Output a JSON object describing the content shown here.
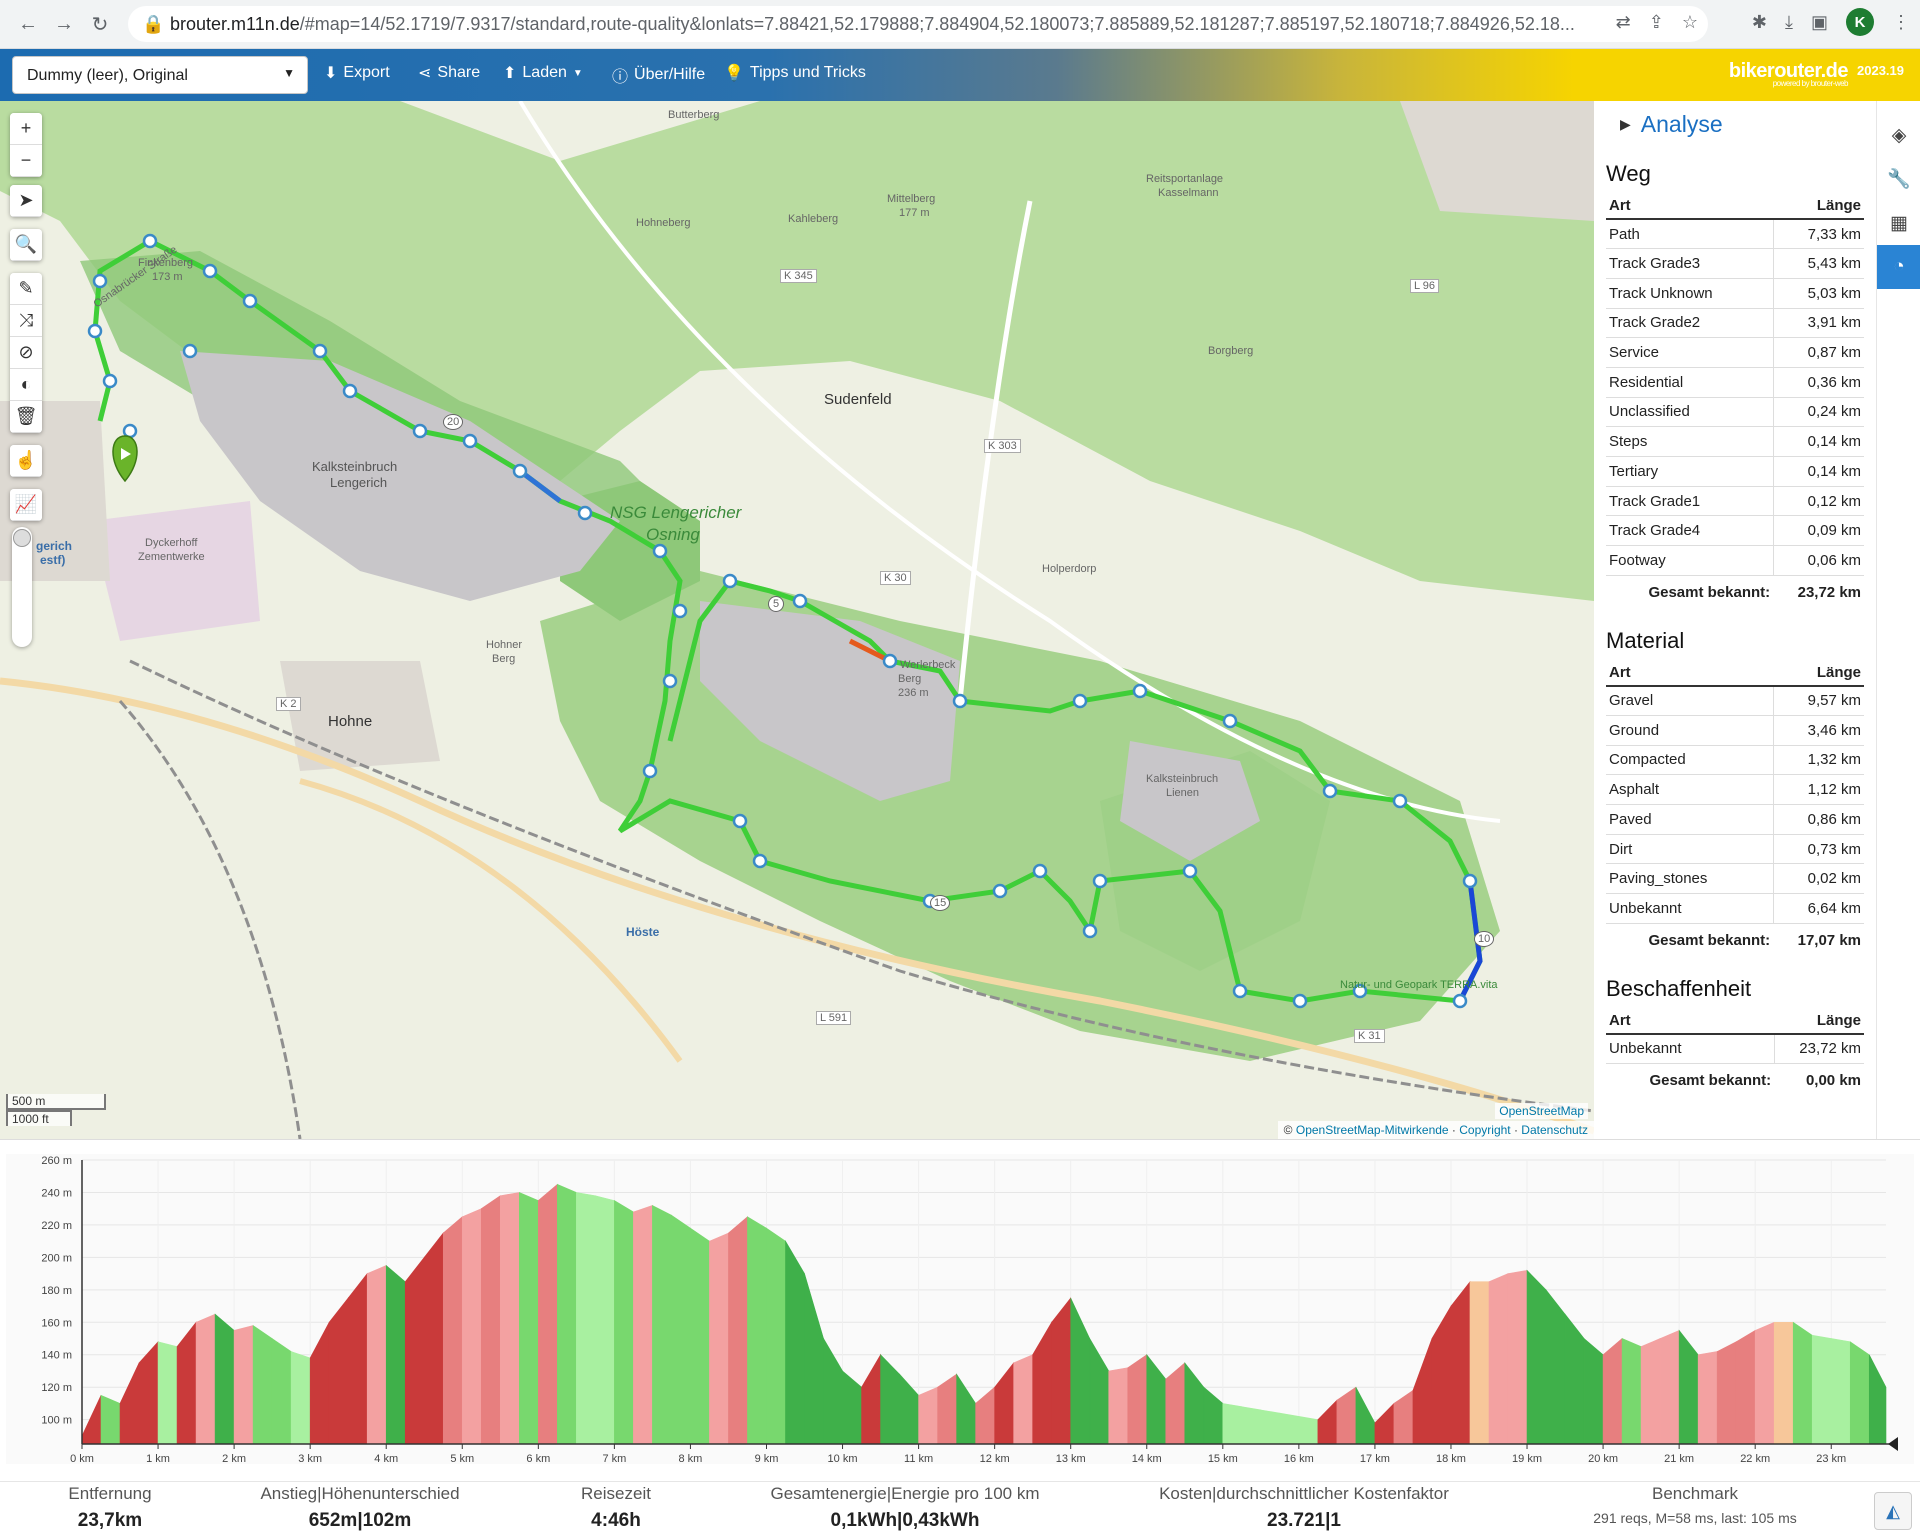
{
  "browser": {
    "url_host": "brouter.m11n.de",
    "url_rest": "/#map=14/52.1719/7.9317/standard,route-quality&lonlats=7.88421,52.179888;7.884904,52.180073;7.885889,52.181287;7.885197,52.180718;7.884926,52.18...",
    "avatar_letter": "K"
  },
  "toolbar": {
    "profile": "Dummy (leer), Original",
    "export": "Export",
    "share": "Share",
    "load": "Laden",
    "about": "Über/Hilfe",
    "tips": "Tipps und Tricks",
    "brand": "bikerouter.de",
    "brand_sub": "powered by brouter-web",
    "version": "2023.19"
  },
  "map": {
    "labels": {
      "butterberg": "Butterberg",
      "hohneberg": "Hohneberg",
      "kahleberg": "Kahleberg",
      "mittelberg": "Mittelberg",
      "mittelberg_h": "177 m",
      "reitsport": "Reitsportanlage",
      "kasselmann": "Kasselmann",
      "borgberg": "Borgberg",
      "sudenfeld": "Sudenfeld",
      "finkenberg": "Finkenberg",
      "finkenberg_h": "173 m",
      "kalkstein1": "Kalksteinbruch",
      "kalkstein1b": "Lengerich",
      "nsg1": "NSG Lengericher",
      "nsg2": "Osning",
      "dyckerhoff": "Dyckerhoff",
      "zementwerke": "Zementwerke",
      "hohnerberg": "Hohner",
      "hohnerberg2": "Berg",
      "hohne": "Hohne",
      "hoeste": "Höste",
      "kalkstein2": "Kalksteinbruch",
      "kalkstein2b": "Lienen",
      "osnabruecker": "Osnabrücker Straße",
      "k345": "K 345",
      "k303": "K 303",
      "k30": "K 30",
      "k2": "K 2",
      "l96": "L 96",
      "k31": "K 31",
      "l591": "L 591",
      "holperdorp": "Holperdorp",
      "lengerich": "gerich",
      "westf": "estf)",
      "werlerbeck": "Werlerbeck",
      "werlerbeck2": "Berg",
      "werlerbeck_h": "236 m",
      "terra": "Natur- und Geopark TERRA.vita",
      "route20": "20",
      "route5": "5",
      "route10": "10",
      "route15": "15"
    },
    "scale_m": "500 m",
    "scale_ft": "1000 ft",
    "attrib_osm": "OpenStreetMap",
    "attrib_contrib": "OpenStreetMap-Mitwirkende",
    "attrib_copyright": "Copyright",
    "attrib_privacy": "Datenschutz",
    "copy_sign": "©"
  },
  "sidebar": {
    "analyse": "Analyse",
    "weg": {
      "title": "Weg",
      "col_type": "Art",
      "col_len": "Länge",
      "rows": [
        {
          "type": "Path",
          "len": "7,33 km"
        },
        {
          "type": "Track Grade3",
          "len": "5,43 km"
        },
        {
          "type": "Track Unknown",
          "len": "5,03 km"
        },
        {
          "type": "Track Grade2",
          "len": "3,91 km"
        },
        {
          "type": "Service",
          "len": "0,87 km"
        },
        {
          "type": "Residential",
          "len": "0,36 km"
        },
        {
          "type": "Unclassified",
          "len": "0,24 km"
        },
        {
          "type": "Steps",
          "len": "0,14 km"
        },
        {
          "type": "Tertiary",
          "len": "0,14 km"
        },
        {
          "type": "Track Grade1",
          "len": "0,12 km"
        },
        {
          "type": "Track Grade4",
          "len": "0,09 km"
        },
        {
          "type": "Footway",
          "len": "0,06 km"
        }
      ],
      "total_label": "Gesamt bekannt:",
      "total": "23,72 km"
    },
    "material": {
      "title": "Material",
      "col_type": "Art",
      "col_len": "Länge",
      "rows": [
        {
          "type": "Gravel",
          "len": "9,57 km"
        },
        {
          "type": "Ground",
          "len": "3,46 km"
        },
        {
          "type": "Compacted",
          "len": "1,32 km"
        },
        {
          "type": "Asphalt",
          "len": "1,12 km"
        },
        {
          "type": "Paved",
          "len": "0,86 km"
        },
        {
          "type": "Dirt",
          "len": "0,73 km"
        },
        {
          "type": "Paving_stones",
          "len": "0,02 km"
        },
        {
          "type": "Unbekannt",
          "len": "6,64 km"
        }
      ],
      "total_label": "Gesamt bekannt:",
      "total": "17,07 km"
    },
    "beschaffenheit": {
      "title": "Beschaffenheit",
      "col_type": "Art",
      "col_len": "Länge",
      "rows": [
        {
          "type": "Unbekannt",
          "len": "23,72 km"
        }
      ],
      "total_label": "Gesamt bekannt:",
      "total": "0,00 km"
    }
  },
  "chart_data": {
    "type": "area",
    "title": "",
    "xlabel": "",
    "ylabel": "",
    "x_unit": "km",
    "y_unit": "m",
    "xlim": [
      0,
      23.72
    ],
    "ylim": [
      85,
      260
    ],
    "x_ticks": [
      "0 km",
      "1 km",
      "2 km",
      "3 km",
      "4 km",
      "5 km",
      "6 km",
      "7 km",
      "8 km",
      "9 km",
      "10 km",
      "11 km",
      "12 km",
      "13 km",
      "14 km",
      "15 km",
      "16 km",
      "17 km",
      "18 km",
      "19 km",
      "20 km",
      "21 km",
      "22 km",
      "23 km"
    ],
    "y_ticks": [
      "100 m",
      "120 m",
      "140 m",
      "160 m",
      "180 m",
      "200 m",
      "220 m",
      "240 m",
      "260 m"
    ],
    "x": [
      0,
      0.25,
      0.5,
      0.75,
      1.0,
      1.25,
      1.5,
      1.75,
      2.0,
      2.25,
      2.5,
      2.75,
      3.0,
      3.25,
      3.5,
      3.75,
      4.0,
      4.25,
      4.5,
      4.75,
      5.0,
      5.25,
      5.5,
      5.75,
      6.0,
      6.25,
      6.5,
      6.75,
      7.0,
      7.25,
      7.5,
      7.75,
      8.0,
      8.25,
      8.5,
      8.75,
      9.0,
      9.25,
      9.5,
      9.75,
      10.0,
      10.25,
      10.5,
      10.75,
      11.0,
      11.25,
      11.5,
      11.75,
      12.0,
      12.25,
      12.5,
      12.75,
      13.0,
      13.25,
      13.5,
      13.75,
      14.0,
      14.25,
      14.5,
      14.75,
      15.0,
      15.25,
      15.5,
      15.75,
      16.0,
      16.25,
      16.5,
      16.75,
      17.0,
      17.25,
      17.5,
      17.75,
      18.0,
      18.25,
      18.5,
      18.75,
      19.0,
      19.25,
      19.5,
      19.75,
      20.0,
      20.25,
      20.5,
      20.75,
      21.0,
      21.25,
      21.5,
      21.75,
      22.0,
      22.25,
      22.5,
      22.75,
      23.0,
      23.25,
      23.5,
      23.72
    ],
    "y": [
      90,
      115,
      110,
      135,
      148,
      145,
      160,
      165,
      155,
      158,
      150,
      142,
      138,
      160,
      175,
      190,
      195,
      185,
      200,
      215,
      225,
      230,
      238,
      240,
      235,
      245,
      240,
      238,
      235,
      228,
      232,
      226,
      218,
      210,
      215,
      225,
      218,
      210,
      190,
      150,
      130,
      120,
      140,
      128,
      115,
      120,
      128,
      110,
      120,
      135,
      140,
      160,
      175,
      150,
      130,
      132,
      140,
      125,
      135,
      120,
      110,
      108,
      106,
      104,
      102,
      100,
      112,
      120,
      98,
      110,
      118,
      150,
      170,
      185,
      185,
      190,
      192,
      180,
      165,
      150,
      140,
      150,
      145,
      150,
      155,
      140,
      142,
      148,
      155,
      160,
      160,
      152,
      150,
      148,
      140,
      120,
      95
    ],
    "segment_colors": [
      "#c93a3a",
      "#e77f7f",
      "#f3a1a1",
      "#f7c79a",
      "#a8f0a0",
      "#78d86e",
      "#3fb04a"
    ]
  },
  "footer": {
    "distance_label": "Entfernung",
    "distance": "23,7km",
    "ascent_label": "Anstieg|Höhenunterschied",
    "ascent": "652m|102m",
    "time_label": "Reisezeit",
    "time": "4:46h",
    "energy_label": "Gesamtenergie|Energie pro 100 km",
    "energy": "0,1kWh|0,43kWh",
    "cost_label": "Kosten|durchschnittlicher Kostenfaktor",
    "cost": "23.721|1",
    "bench_label": "Benchmark",
    "bench": "291 reqs, M=58 ms, last: 105 ms"
  }
}
